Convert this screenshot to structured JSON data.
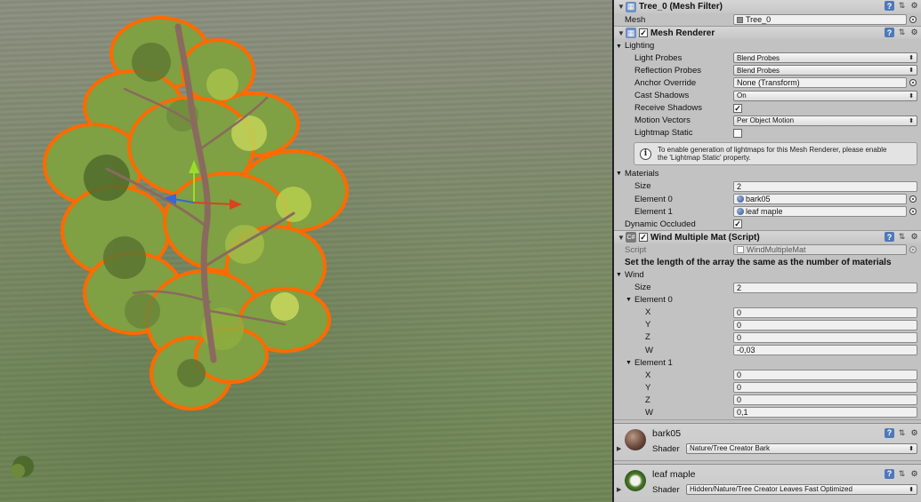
{
  "inspector": {
    "mesh_filter": {
      "title": "Tree_0 (Mesh Filter)",
      "mesh_label": "Mesh",
      "mesh_value": "Tree_0"
    },
    "mesh_renderer": {
      "title": "Mesh Renderer",
      "enabled": true,
      "lighting_label": "Lighting",
      "light_probes_label": "Light Probes",
      "light_probes_value": "Blend Probes",
      "reflection_probes_label": "Reflection Probes",
      "reflection_probes_value": "Blend Probes",
      "anchor_override_label": "Anchor Override",
      "anchor_override_value": "None (Transform)",
      "cast_shadows_label": "Cast Shadows",
      "cast_shadows_value": "On",
      "receive_shadows_label": "Receive Shadows",
      "receive_shadows_checked": true,
      "motion_vectors_label": "Motion Vectors",
      "motion_vectors_value": "Per Object Motion",
      "lightmap_static_label": "Lightmap Static",
      "lightmap_static_checked": false,
      "help_line1": "To enable generation of lightmaps for this Mesh Renderer, please enable",
      "help_line2": "the 'Lightmap Static' property.",
      "materials_label": "Materials",
      "size_label": "Size",
      "size_value": "2",
      "element0_label": "Element 0",
      "element0_value": "bark05",
      "element1_label": "Element 1",
      "element1_value": "leaf maple",
      "dynamic_occluded_label": "Dynamic Occluded",
      "dynamic_occluded_checked": true
    },
    "wind_script": {
      "title": "Wind Multiple Mat (Script)",
      "enabled": true,
      "script_label": "Script",
      "script_value": "WindMultipleMat",
      "note": "Set the length of the array the same as the number of materials",
      "wind_label": "Wind",
      "size_label": "Size",
      "size_value": "2",
      "elements": [
        {
          "label": "Element 0",
          "x_label": "X",
          "x": "0",
          "y_label": "Y",
          "y": "0",
          "z_label": "Z",
          "z": "0",
          "w_label": "W",
          "w": "-0,03"
        },
        {
          "label": "Element 1",
          "x_label": "X",
          "x": "0",
          "y_label": "Y",
          "y": "0",
          "z_label": "Z",
          "z": "0",
          "w_label": "W",
          "w": "0,1"
        }
      ]
    },
    "materials": [
      {
        "name": "bark05",
        "shader_label": "Shader",
        "shader": "Nature/Tree Creator Bark"
      },
      {
        "name": "leaf maple",
        "shader_label": "Shader",
        "shader": "Hidden/Nature/Tree Creator Leaves Fast Optimized"
      }
    ]
  },
  "icons": {
    "foldout": "triangle-down-icon",
    "help": "help-icon",
    "preset": "preset-icon",
    "settings": "gear-icon",
    "object_picker": "object-picker-icon",
    "info": "info-icon"
  },
  "colors": {
    "selection_outline": "#ff6a00",
    "inspector_bg": "#c2c2c2",
    "gizmo_y": "#9bdc2a",
    "gizmo_x": "#d9431e",
    "gizmo_z": "#3a66d6"
  }
}
